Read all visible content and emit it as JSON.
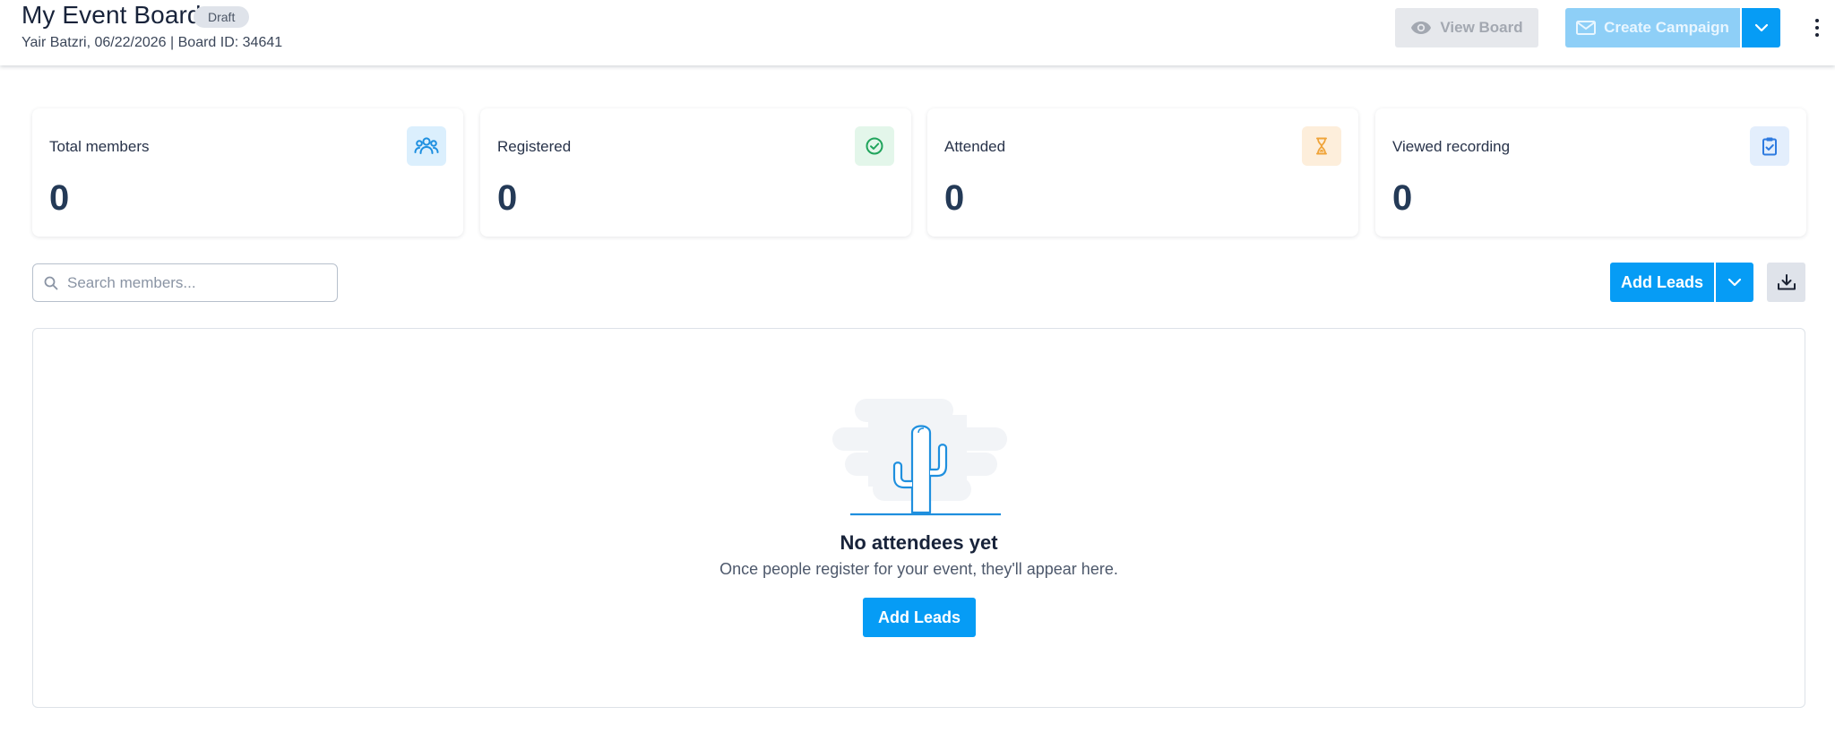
{
  "header": {
    "title": "My Event Board",
    "badge": "Draft",
    "meta": "Yair Batzri, 06/22/2026 | Board ID: 34641",
    "view_board_label": "View Board",
    "create_campaign_label": "Create Campaign"
  },
  "stats": [
    {
      "label": "Total members",
      "value": "0",
      "icon": "members-icon",
      "icon_color": "#1d8fe0",
      "icon_bg": "#dbeffd"
    },
    {
      "label": "Registered",
      "value": "0",
      "icon": "check-circle-icon",
      "icon_color": "#20a45c",
      "icon_bg": "#e3f6ea"
    },
    {
      "label": "Attended",
      "value": "0",
      "icon": "hourglass-icon",
      "icon_color": "#f0a43a",
      "icon_bg": "#fdeedb"
    },
    {
      "label": "Viewed recording",
      "value": "0",
      "icon": "clipboard-check-icon",
      "icon_color": "#2e7be0",
      "icon_bg": "#e3eefc"
    }
  ],
  "toolbar": {
    "search_placeholder": "Search members...",
    "search_value": "",
    "add_leads_label": "Add Leads"
  },
  "empty_state": {
    "title": "No attendees yet",
    "subtitle": "Once people register for your event, they'll appear here.",
    "button_label": "Add Leads"
  },
  "colors": {
    "primary": "#069cf5",
    "primary_disabled": "#8ecff7",
    "text_dark": "#18233a",
    "value_color": "#243a57"
  }
}
